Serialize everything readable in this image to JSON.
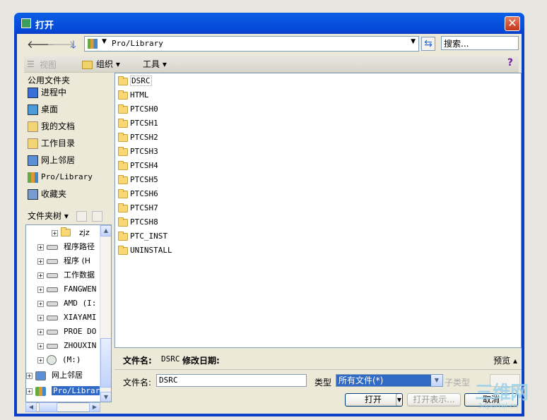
{
  "window": {
    "title": "打开",
    "close_glyph": "✕"
  },
  "nav": {
    "back_glyph": "🡐",
    "forward_glyph": "🡒",
    "down_glyph": "🡓",
    "address": "Pro/Library",
    "refresh_glyph": "⇆",
    "search_placeholder": "搜索..."
  },
  "toolbar": {
    "view_label": "视图",
    "organize_label": "组织 ▾",
    "tools_label": "工具 ▾",
    "help_glyph": "?"
  },
  "favorites": {
    "header": "公用文件夹",
    "items": [
      {
        "label": "进程中",
        "icon": "in-session-icon"
      },
      {
        "label": "桌面",
        "icon": "desktop-icon"
      },
      {
        "label": "我的文档",
        "icon": "my-documents-icon"
      },
      {
        "label": "工作目录",
        "icon": "working-directory-icon"
      },
      {
        "label": "网上邻居",
        "icon": "network-icon"
      },
      {
        "label": "Pro/Library",
        "icon": "library-icon"
      },
      {
        "label": "收藏夹",
        "icon": "favorites-icon"
      }
    ]
  },
  "tree": {
    "header": "文件夹树 ▾",
    "nodes": [
      {
        "label": "zjz",
        "kind": "folder"
      },
      {
        "label": "程序路径",
        "kind": "drive"
      },
      {
        "label": "程序 (H",
        "kind": "drive"
      },
      {
        "label": "工作数据",
        "kind": "drive"
      },
      {
        "label": "FANGWEN",
        "kind": "drive"
      },
      {
        "label": "AMD (I:",
        "kind": "drive"
      },
      {
        "label": "XIAYAMI",
        "kind": "drive"
      },
      {
        "label": "PROE DO",
        "kind": "drive"
      },
      {
        "label": "ZHOUXIN",
        "kind": "drive"
      },
      {
        "label": "(M:)",
        "kind": "cdrom"
      },
      {
        "label": "网上邻居",
        "kind": "network"
      },
      {
        "label": "Pro/Library",
        "kind": "library"
      }
    ]
  },
  "files": [
    "DSRC",
    "HTML",
    "PTCSH0",
    "PTCSH1",
    "PTCSH2",
    "PTCSH3",
    "PTCSH4",
    "PTCSH5",
    "PTCSH6",
    "PTCSH7",
    "PTCSH8",
    "PTC_INST",
    "UNINSTALL"
  ],
  "preview": {
    "name_label": "文件名:",
    "name_value": "DSRC",
    "date_label": "修改日期:",
    "toggle_label": "预览 ▴"
  },
  "bottom": {
    "filename_label": "文件名:",
    "filename_value": "DSRC",
    "type_label": "类型",
    "type_value": "所有文件(*)",
    "subtype_label": "子类型",
    "open_label": "打开",
    "open_as_label": "打开表示...",
    "cancel_label": "取消"
  },
  "watermark": {
    "title": "三维网",
    "url": "3dportal.cn"
  }
}
